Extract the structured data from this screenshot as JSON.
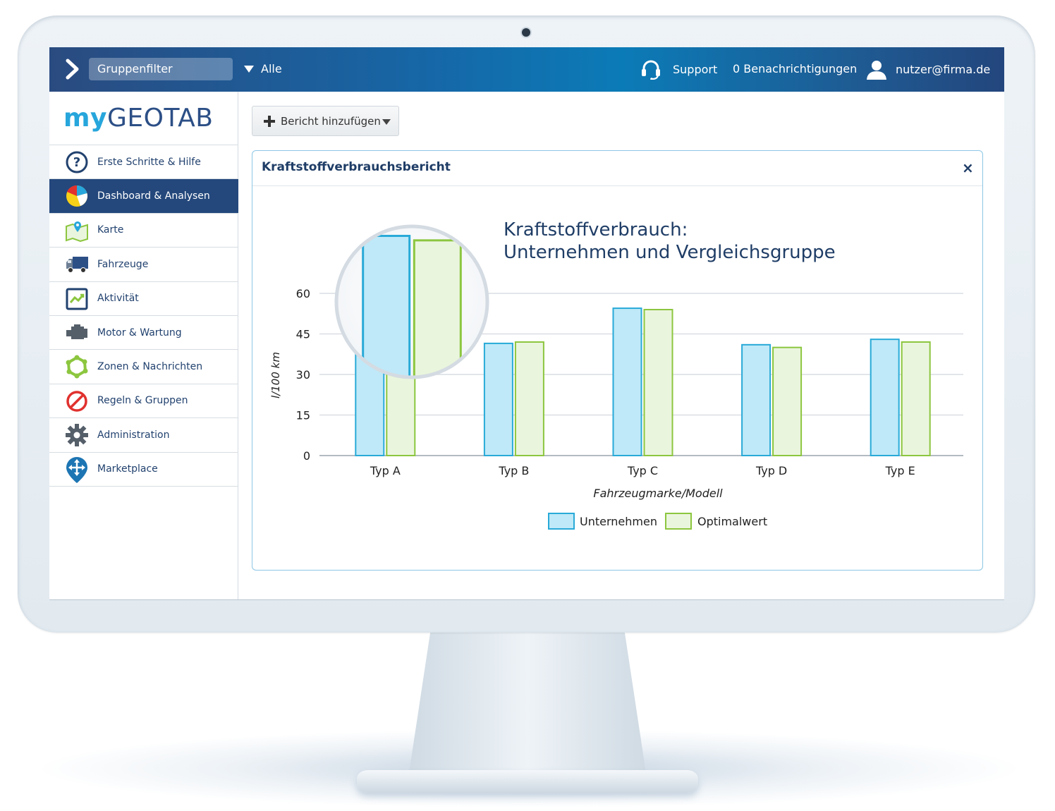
{
  "topbar": {
    "group_filter_placeholder": "Gruppenfilter",
    "group_value": "Alle",
    "support_label": "Support",
    "notifications_label": "0 Benachrichtigungen",
    "user_email": "nutzer@firma.de",
    "gradient_start": "#2a4b80",
    "gradient_mid": "#0b7bb7"
  },
  "logo": {
    "my": "my",
    "geotab": "GEOTAB"
  },
  "sidebar": {
    "items": [
      {
        "label": "Erste Schritte & Hilfe",
        "icon": "help-icon",
        "active": false
      },
      {
        "label": "Dashboard & Analysen",
        "icon": "pie-chart-icon",
        "active": true
      },
      {
        "label": "Karte",
        "icon": "map-icon",
        "active": false
      },
      {
        "label": "Fahrzeuge",
        "icon": "truck-icon",
        "active": false
      },
      {
        "label": "Aktivität",
        "icon": "activity-icon",
        "active": false
      },
      {
        "label": "Motor & Wartung",
        "icon": "engine-icon",
        "active": false
      },
      {
        "label": "Zonen & Nachrichten",
        "icon": "zone-icon",
        "active": false
      },
      {
        "label": "Regeln & Gruppen",
        "icon": "prohibited-icon",
        "active": false
      },
      {
        "label": "Administration",
        "icon": "gear-icon",
        "active": false
      },
      {
        "label": "Marketplace",
        "icon": "marketplace-icon",
        "active": false
      }
    ],
    "active_color": "#24487c"
  },
  "toolbar": {
    "add_report_label": "Bericht hinzufügen"
  },
  "panel": {
    "title": "Kraftstoffverbrauchsbericht",
    "close": "×"
  },
  "chart_data": {
    "type": "bar",
    "title_line1": "Kraftstoffverbrauch:",
    "title_line2": "Unternehmen und Vergleichsgruppe",
    "categories": [
      "Typ A",
      "Typ B",
      "Typ C",
      "Typ D",
      "Typ E"
    ],
    "series": [
      {
        "name": "Unternehmen",
        "values": [
          44,
          41.5,
          54.5,
          41,
          43
        ],
        "color": "#29aad8",
        "fill": "#bfe9f8"
      },
      {
        "name": "Optimalwert",
        "values": [
          43,
          42,
          54,
          40,
          42
        ],
        "color": "#8cc63f",
        "fill": "#eaf5dd"
      }
    ],
    "magnified": {
      "category": "Typ A",
      "values": [
        44,
        43
      ]
    },
    "xlabel": "Fahrzeugmarke/Modell",
    "ylabel": "l/100 km",
    "yticks": [
      0,
      15,
      30,
      45,
      60
    ],
    "ylim": [
      0,
      60
    ],
    "grid": true,
    "legend_position": "bottom-center"
  }
}
